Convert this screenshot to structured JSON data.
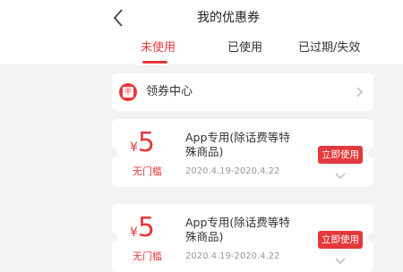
{
  "header": {
    "title": "我的优惠券"
  },
  "tabs": [
    {
      "label": "未使用",
      "active": true
    },
    {
      "label": "已使用",
      "active": false
    },
    {
      "label": "已过期/失效",
      "active": false
    }
  ],
  "coupon_center": {
    "icon": "coupon-icon",
    "icon_glyph": "半",
    "label": "领券中心"
  },
  "coupons": [
    {
      "currency": "¥",
      "amount": "5",
      "threshold": "无门槛",
      "description": "App专用(除话费等特殊商品)",
      "valid_period": "2020.4.19-2020.4.22",
      "action_label": "立即使用"
    },
    {
      "currency": "¥",
      "amount": "5",
      "threshold": "无门槛",
      "description": "App专用(除话费等特殊商品)",
      "valid_period": "2020.4.19-2020.4.22",
      "action_label": "立即使用"
    }
  ],
  "colors": {
    "accent": "#e4393c",
    "background": "#f3f3f3"
  }
}
